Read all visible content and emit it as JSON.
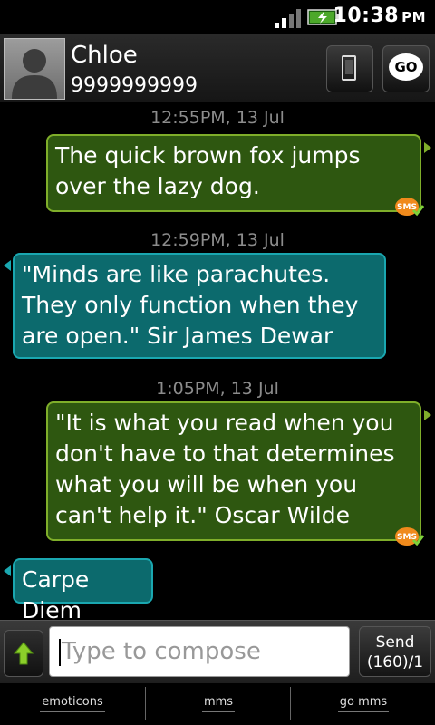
{
  "status_bar": {
    "time": "10:38",
    "ampm": "PM"
  },
  "header": {
    "contact_name": "Chloe",
    "contact_number": "9999999999",
    "phone_button_icon": "phone-icon",
    "go_button_label": "GO"
  },
  "messages": [
    {
      "timestamp": "12:55PM, 13 Jul",
      "direction": "sent",
      "text": "The quick brown fox jumps over the lazy dog.",
      "badge": "SMS"
    },
    {
      "timestamp": "12:59PM, 13 Jul",
      "direction": "received",
      "text": "\"Minds are like parachutes. They only function when they are open.\" Sir James Dewar"
    },
    {
      "timestamp": "1:05PM, 13 Jul",
      "direction": "sent",
      "text": "\"It is what you read when you don't have to that determines what you will be when you can't help it.\" Oscar Wilde",
      "badge": "SMS"
    },
    {
      "direction": "received",
      "text": "Carpe Diem"
    }
  ],
  "composer": {
    "placeholder": "Type to compose",
    "send_label": "Send",
    "send_counter": "(160)/1"
  },
  "bottom_bar": {
    "items": [
      "emoticons",
      "mms",
      "go mms"
    ]
  },
  "colors": {
    "sent_bubble": "#2e5710",
    "sent_border": "#7fae2a",
    "received_bubble": "#0c6a6d",
    "received_border": "#1aa7b0"
  }
}
